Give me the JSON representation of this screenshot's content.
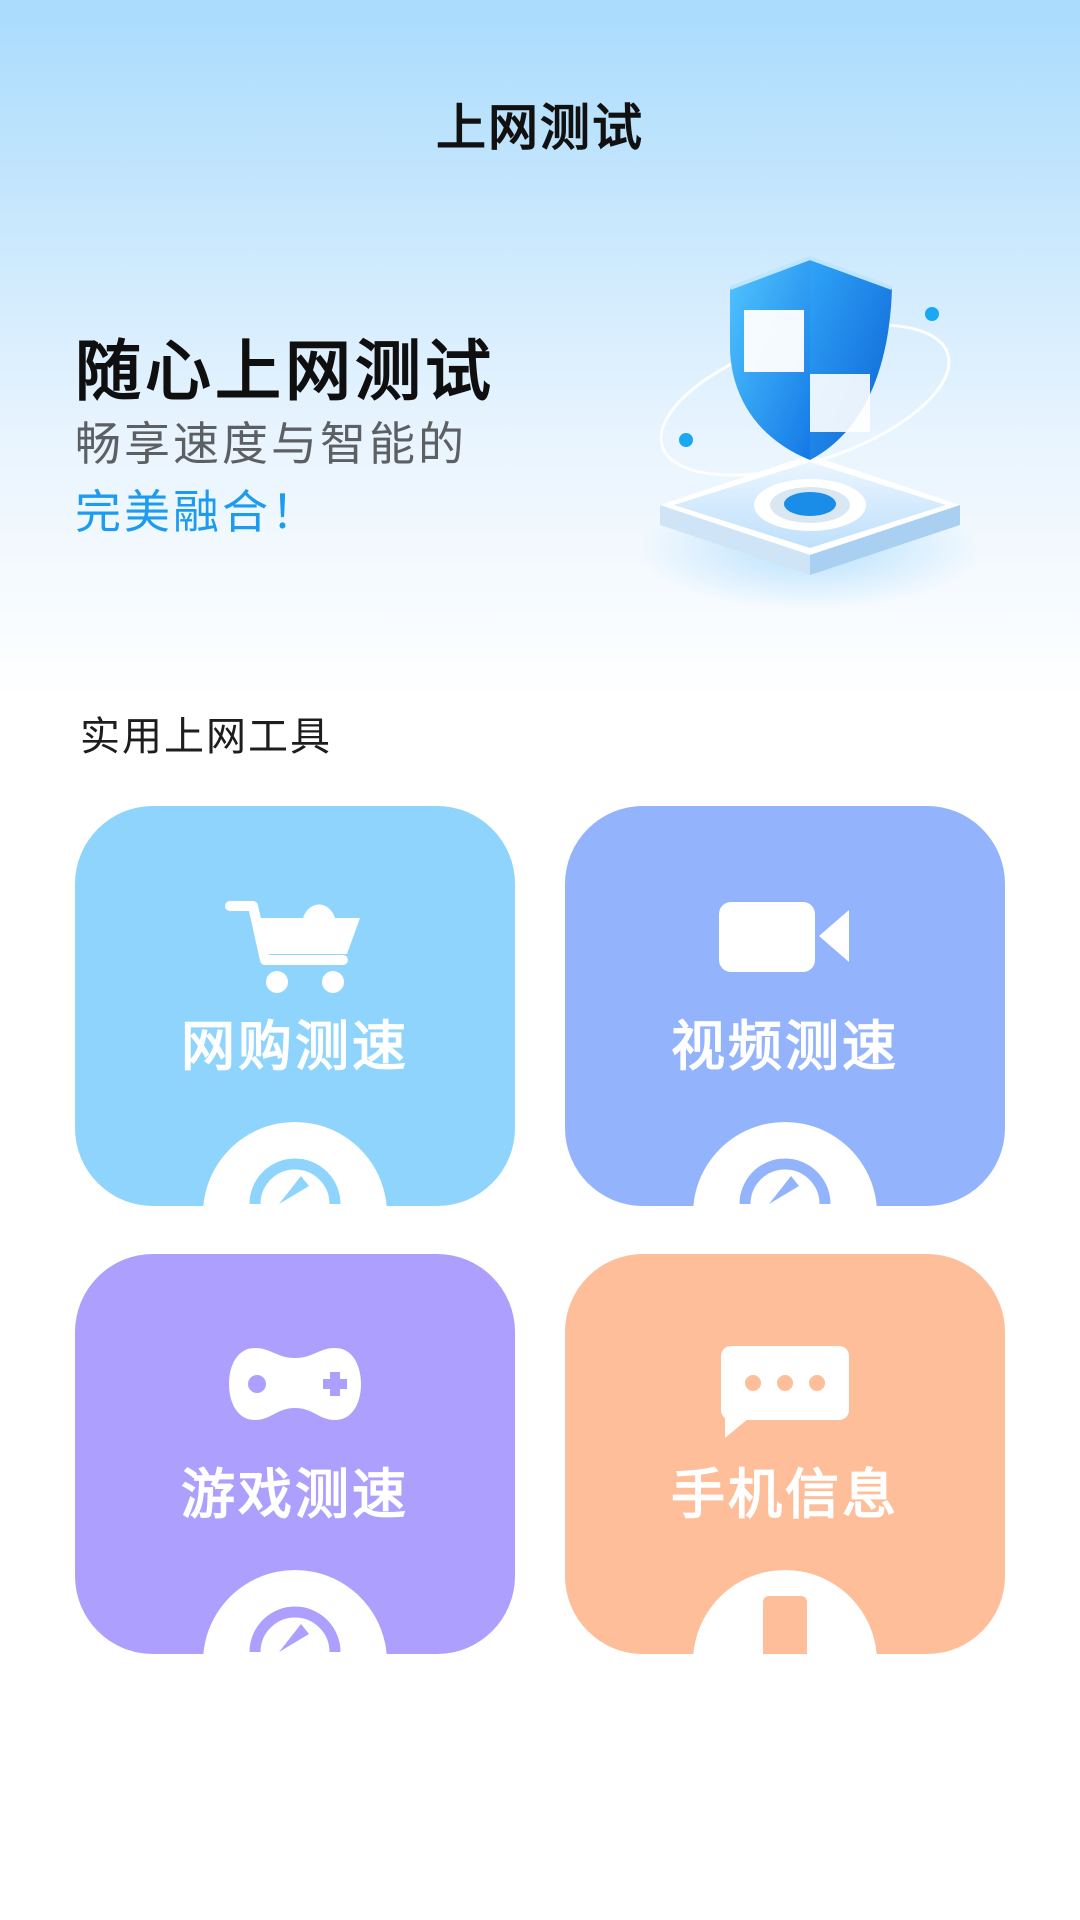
{
  "header": {
    "title": "上网测试"
  },
  "hero": {
    "line1": "随心上网测试",
    "line2": "畅享速度与智能的",
    "line3": "完美融合！",
    "illustration": "shield-on-platform-illustration"
  },
  "tools": {
    "section_title": "实用上网工具",
    "cards": [
      {
        "label": "网购测速",
        "icon": "shopping-cart-icon",
        "badge_icon": "speedometer-icon",
        "color": "#8ed4fd"
      },
      {
        "label": "视频测速",
        "icon": "video-camera-icon",
        "badge_icon": "speedometer-icon",
        "color": "#93b3fd"
      },
      {
        "label": "游戏测速",
        "icon": "gamepad-icon",
        "badge_icon": "speedometer-icon",
        "color": "#ac9ffd"
      },
      {
        "label": "手机信息",
        "icon": "chat-bubble-icon",
        "badge_icon": "smartphone-icon",
        "color": "#fdbe99"
      }
    ]
  },
  "colors": {
    "accent": "#1c9bf0"
  }
}
